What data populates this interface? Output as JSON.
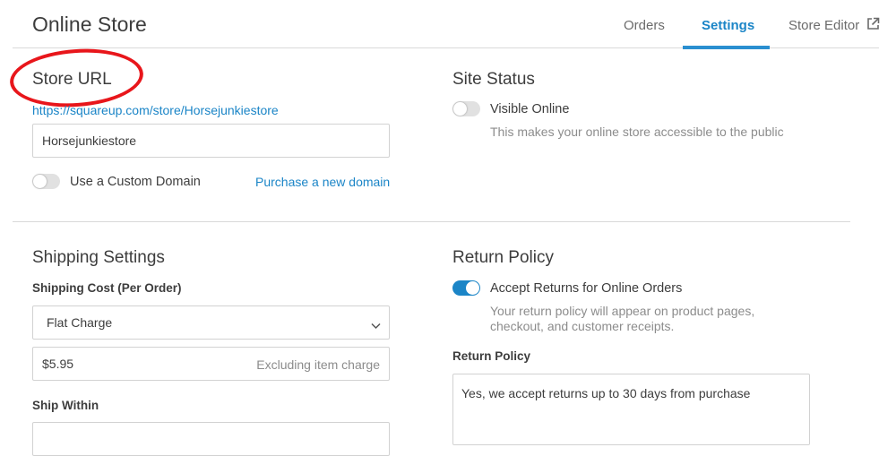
{
  "header": {
    "title": "Online Store",
    "tabs": [
      {
        "label": "Orders",
        "active": false
      },
      {
        "label": "Settings",
        "active": true
      },
      {
        "label": "Store Editor",
        "active": false,
        "icon": "external-link-icon"
      }
    ]
  },
  "store_url": {
    "title": "Store URL",
    "url": "https://squareup.com/store/Horsejunkiestore",
    "slug_value": "Horsejunkiestore",
    "custom_domain_label": "Use a Custom Domain",
    "custom_domain_enabled": false,
    "purchase_link": "Purchase a new domain"
  },
  "site_status": {
    "title": "Site Status",
    "visible_label": "Visible Online",
    "visible_enabled": false,
    "help": "This makes your online store accessible to the public"
  },
  "shipping": {
    "title": "Shipping Settings",
    "cost_label": "Shipping Cost (Per Order)",
    "cost_type": "Flat Charge",
    "amount": "$5.95",
    "amount_hint": "Excluding item charge",
    "ship_within_label": "Ship Within"
  },
  "return_policy": {
    "title": "Return Policy",
    "accept_label": "Accept Returns for Online Orders",
    "accept_enabled": true,
    "help_line1": "Your return policy will appear on product pages,",
    "help_line2": "checkout, and customer receipts.",
    "policy_label": "Return Policy",
    "policy_text": "Yes, we accept returns up to 30 days from purchase"
  },
  "colors": {
    "accent": "#1b85c7",
    "annotation": "#e8161b",
    "text": "#3d3d3d",
    "muted": "#8c8c8c"
  }
}
